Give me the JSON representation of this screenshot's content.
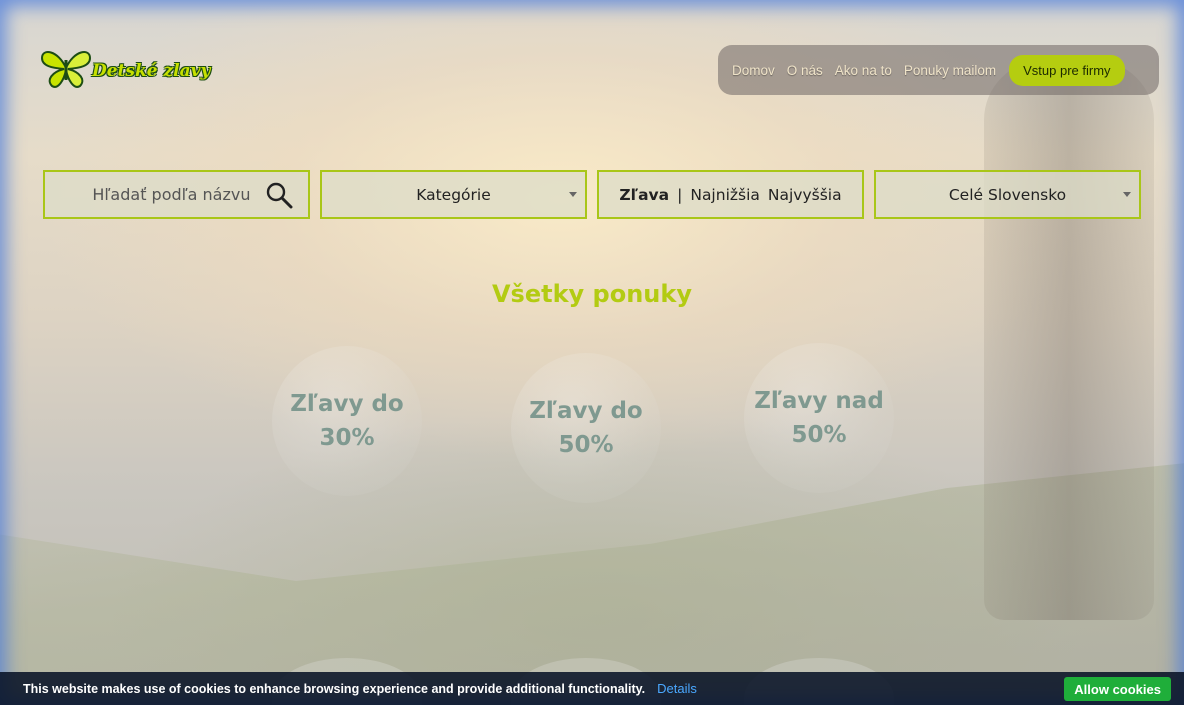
{
  "brand": {
    "logo_text": "Detské zlavy",
    "logo_icon": "butterfly-icon"
  },
  "nav": {
    "items": [
      {
        "label": "Domov"
      },
      {
        "label": "O nás"
      },
      {
        "label": "Ako na to"
      },
      {
        "label": "Ponuky mailom"
      }
    ],
    "cta_label": "Vstup pre firmy"
  },
  "filters": {
    "search_placeholder": "Hľadať podľa názvu",
    "search_icon": "search-icon",
    "category_label": "Kategórie",
    "sort": {
      "active": "Zľava",
      "separator": "|",
      "lowest": "Najnižšia",
      "highest": "Najvyššia"
    },
    "region_label": "Celé Slovensko"
  },
  "main": {
    "title": "Všetky ponuky",
    "bubbles": [
      {
        "line1": "Zľavy do",
        "line2": "30%"
      },
      {
        "line1": "Zľavy do",
        "line2": "50%"
      },
      {
        "line1": "Zľavy nad",
        "line2": "50%"
      }
    ]
  },
  "cookie_bar": {
    "message": "This website makes use of cookies to enhance browsing experience and provide additional functionality.",
    "details_label": "Details",
    "allow_label": "Allow cookies"
  },
  "colors": {
    "accent": "#b3cb12",
    "frame": "#4678dc",
    "cookie_bg": "#081226",
    "allow_button": "#1fae3a",
    "details_link": "#4aa8ff"
  }
}
